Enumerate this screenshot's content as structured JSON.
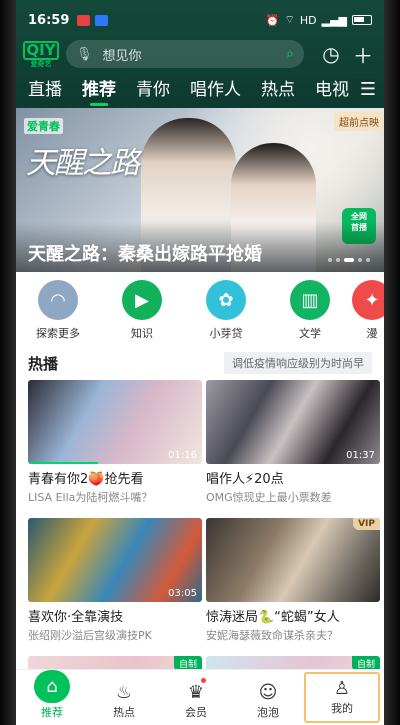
{
  "status": {
    "time": "16:59",
    "right_text": "HD",
    "icons": [
      "notification-icon-red",
      "notification-icon-blue",
      "alarm-icon",
      "wifi-icon",
      "signal-icon",
      "battery-icon"
    ]
  },
  "header": {
    "logo_main": "QIY",
    "logo_sub": "爱奇艺",
    "search_placeholder": "想见你",
    "tabs": [
      "直播",
      "推荐",
      "青你",
      "唱作人",
      "热点",
      "电视"
    ],
    "active_tab": "推荐"
  },
  "banner": {
    "title": "天醒之路：秦桑出嫁路平抢婚",
    "calligraphy": "天醒之路",
    "brand_tag": "爱青春",
    "corner_badge": "超前点映",
    "premiere_badge": [
      "全网",
      "首播"
    ]
  },
  "categories": [
    {
      "label": "探索更多",
      "icon": "explore-icon",
      "color": "#7f9bb8"
    },
    {
      "label": "知识",
      "icon": "knowledge-icon",
      "color": "#12b25c"
    },
    {
      "label": "小芽贷",
      "icon": "sprout-icon",
      "color": "#33c0d9"
    },
    {
      "label": "文学",
      "icon": "book-icon",
      "color": "#10b463"
    },
    {
      "label": "漫",
      "icon": "comic-icon",
      "color": "#ef4b4b"
    }
  ],
  "hot": {
    "title": "热播",
    "tag": "调低疫情响应级别为时尚早",
    "cards": [
      {
        "title": "青春有你2🍑抢先看",
        "sub": "LISA Ella为陆柯燃斗嘴？",
        "duration": "01:16",
        "badge": ""
      },
      {
        "title": "唱作人⚡20点",
        "sub": "OMG惊现史上最小票数差",
        "duration": "01:37",
        "badge": ""
      },
      {
        "title": "喜欢你·全靠演技",
        "sub": "张绍刚沙溢后宫级演技PK",
        "duration": "03:05",
        "badge": ""
      },
      {
        "title": "惊涛迷局🐍“蛇蝎”女人",
        "sub": "安妮海瑟薇致命谋杀亲夫？",
        "duration": "",
        "badge": "VIP"
      },
      {
        "title": "",
        "sub": "",
        "duration": "",
        "badge": "自制"
      },
      {
        "title": "",
        "sub": "",
        "duration": "",
        "badge": "自制"
      }
    ]
  },
  "nav": {
    "items": [
      "推荐",
      "热点",
      "会员",
      "泡泡",
      "我的"
    ],
    "active": "推荐"
  }
}
